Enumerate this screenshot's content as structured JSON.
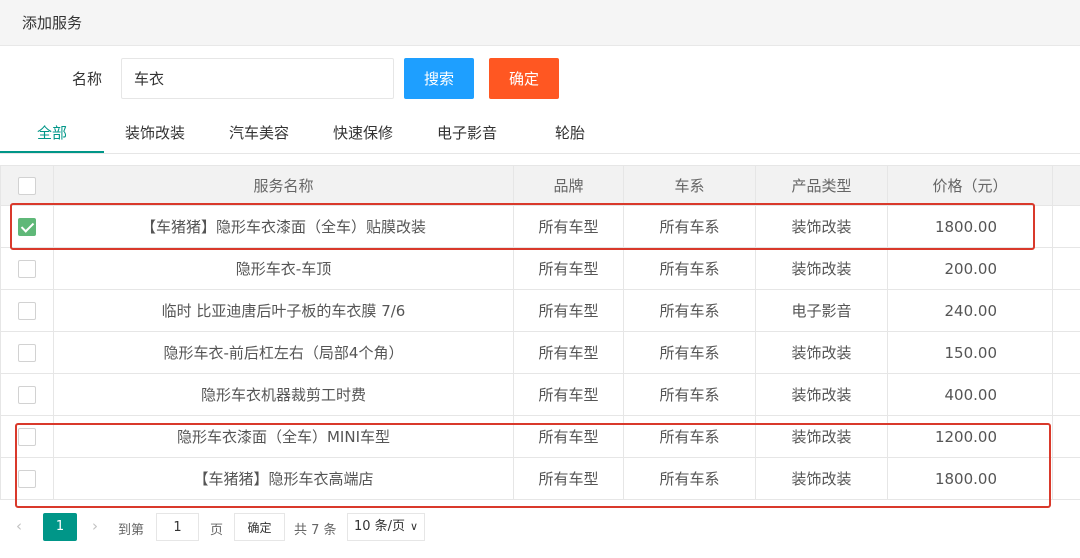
{
  "header": {
    "title": "添加服务"
  },
  "search": {
    "label": "名称",
    "value": "车衣",
    "search_button": "搜索",
    "confirm_button": "确定"
  },
  "tabs": [
    {
      "label": "全部",
      "active": true
    },
    {
      "label": "装饰改装"
    },
    {
      "label": "汽车美容"
    },
    {
      "label": "快速保修"
    },
    {
      "label": "电子影音"
    },
    {
      "label": "轮胎"
    }
  ],
  "table": {
    "headers": [
      "服务名称",
      "品牌",
      "车系",
      "产品类型",
      "价格（元）"
    ],
    "rows": [
      {
        "checked": true,
        "name": "【车猪猪】隐形车衣漆面（全车）贴膜改装",
        "brand": "所有车型",
        "series": "所有车系",
        "type": "装饰改装",
        "price": "1800.00"
      },
      {
        "checked": false,
        "name": "隐形车衣-车顶",
        "brand": "所有车型",
        "series": "所有车系",
        "type": "装饰改装",
        "price": "200.00"
      },
      {
        "checked": false,
        "name": "临时 比亚迪唐后叶子板的车衣膜 7/6",
        "brand": "所有车型",
        "series": "所有车系",
        "type": "电子影音",
        "price": "240.00"
      },
      {
        "checked": false,
        "name": "隐形车衣-前后杠左右（局部4个角）",
        "brand": "所有车型",
        "series": "所有车系",
        "type": "装饰改装",
        "price": "150.00"
      },
      {
        "checked": false,
        "name": "隐形车衣机器裁剪工时费",
        "brand": "所有车型",
        "series": "所有车系",
        "type": "装饰改装",
        "price": "400.00"
      },
      {
        "checked": false,
        "name": "隐形车衣漆面（全车）MINI车型",
        "brand": "所有车型",
        "series": "所有车系",
        "type": "装饰改装",
        "price": "1200.00"
      },
      {
        "checked": false,
        "name": "【车猪猪】隐形车衣高端店",
        "brand": "所有车型",
        "series": "所有车系",
        "type": "装饰改装",
        "price": "1800.00"
      }
    ]
  },
  "pager": {
    "current_page": "1",
    "goto_label": "到第",
    "goto_value": "1",
    "page_label": "页",
    "goto_button": "确定",
    "total": "共 7 条",
    "page_size": "10 条/页"
  },
  "colors": {
    "primary_blue": "#1e9fff",
    "confirm_orange": "#ff5722",
    "tab_active": "#009688",
    "checkbox_checked": "#5fb878",
    "highlight_red": "#d9392b"
  }
}
